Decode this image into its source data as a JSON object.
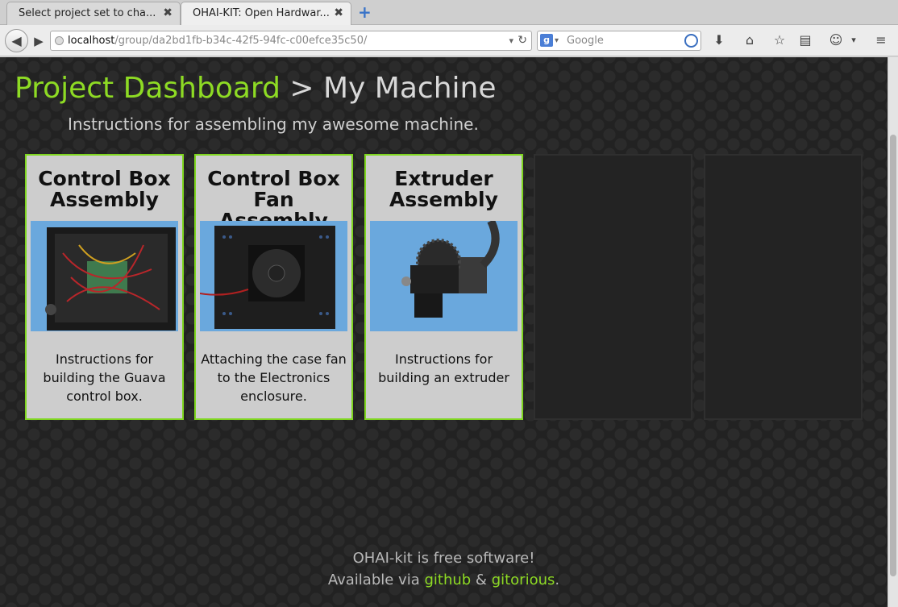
{
  "browser": {
    "tabs": [
      {
        "title": "Select project set to cha...",
        "active": false
      },
      {
        "title": "OHAI-KIT: Open Hardwar...",
        "active": true
      }
    ],
    "url": {
      "host": "localhost",
      "path": "/group/da2bd1fb-b34c-42f5-94fc-c00efce35c50/"
    },
    "search_placeholder": "Google",
    "tab_close_glyph": "✖",
    "new_tab_glyph": "+",
    "icons": [
      "back-icon",
      "forward-icon",
      "reload-icon",
      "download-icon",
      "home-icon",
      "bookmark-star-icon",
      "reader-icon",
      "profile-icon",
      "menu-icon"
    ]
  },
  "header": {
    "project_link": "Project Dashboard",
    "separator": " > ",
    "current": "My Machine",
    "subtitle": "Instructions for assembling my awesome machine."
  },
  "cards": [
    {
      "title": "Control Box Assembly",
      "description": "Instructions for building the Guava control box.",
      "image": "control-box-photo"
    },
    {
      "title": "Control Box Fan Assembly",
      "description": "Attaching the case fan to the Electronics enclosure.",
      "image": "case-fan-photo"
    },
    {
      "title": "Extruder Assembly",
      "description": "Instructions for building an extruder",
      "image": "extruder-photo"
    }
  ],
  "empty_slots": 2,
  "footer": {
    "line1": "OHAI-kit is free software!",
    "line2_prefix": "Available via ",
    "github": "github",
    "amp": " & ",
    "gitorious": "gitorious",
    "period": "."
  },
  "colors": {
    "accent": "#8edb24",
    "card_bg": "#cdcdcd",
    "page_bg": "#222222"
  }
}
